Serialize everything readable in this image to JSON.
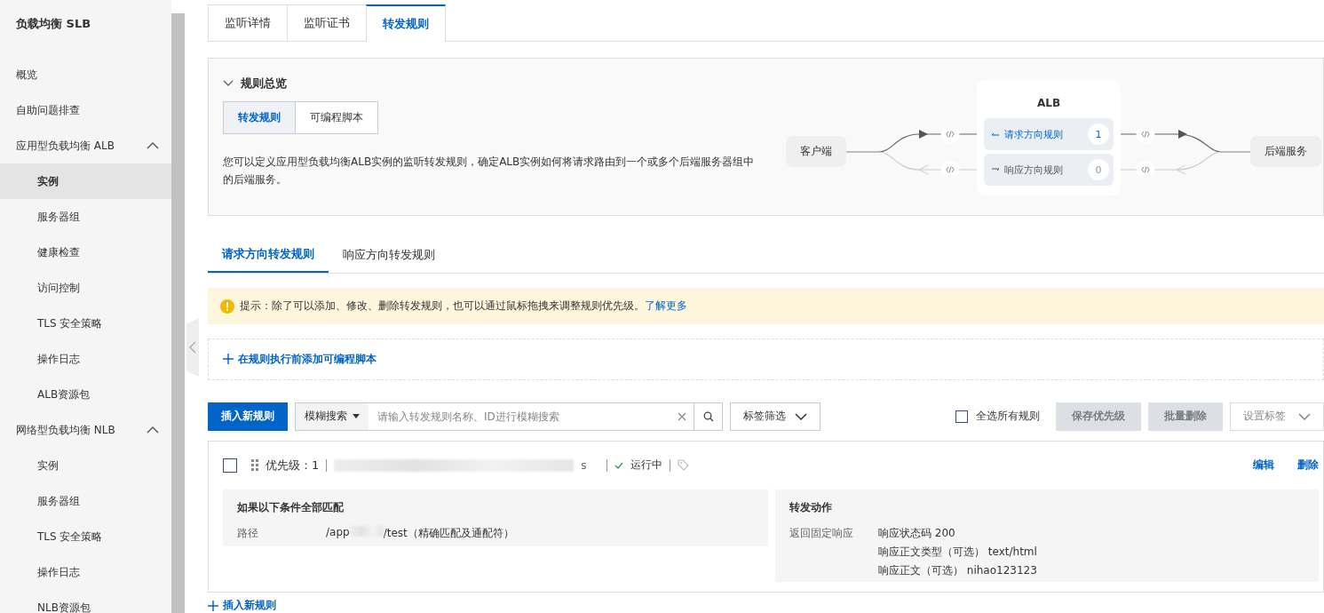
{
  "sidebar": {
    "title": "负载均衡 SLB",
    "items": [
      {
        "label": "概览",
        "selected": false
      },
      {
        "label": "自助问题排查",
        "selected": false
      },
      {
        "label": "应用型负载均衡 ALB",
        "expanded": true,
        "children": [
          {
            "label": "实例",
            "selected": true
          },
          {
            "label": "服务器组",
            "selected": false
          },
          {
            "label": "健康检查",
            "selected": false
          },
          {
            "label": "访问控制",
            "selected": false
          },
          {
            "label": "TLS 安全策略",
            "selected": false
          },
          {
            "label": "操作日志",
            "selected": false
          },
          {
            "label": "ALB资源包",
            "selected": false
          }
        ]
      },
      {
        "label": "网络型负载均衡 NLB",
        "expanded": true,
        "children": [
          {
            "label": "实例",
            "selected": false
          },
          {
            "label": "服务器组",
            "selected": false
          },
          {
            "label": "TLS 安全策略",
            "selected": false
          },
          {
            "label": "操作日志",
            "selected": false
          },
          {
            "label": "NLB资源包",
            "selected": false
          }
        ]
      }
    ]
  },
  "tabs": [
    {
      "label": "监听详情",
      "selected": false
    },
    {
      "label": "监听证书",
      "selected": false
    },
    {
      "label": "转发规则",
      "selected": true
    }
  ],
  "overview": {
    "title": "规则总览",
    "expanded": true,
    "segments": [
      {
        "label": "转发规则",
        "selected": true
      },
      {
        "label": "可编程脚本",
        "selected": false
      }
    ],
    "description": "您可以定义应用型负载均衡ALB实例的监听转发规则，确定ALB实例如何将请求路由到一个或多个后端服务器组中的后端服务。",
    "diagram": {
      "client": "客户端",
      "alb": "ALB",
      "backend": "后端服务",
      "flows": [
        {
          "label": "请求方向规则",
          "count": "1",
          "active": true
        },
        {
          "label": "响应方向规则",
          "count": "0",
          "active": false
        }
      ]
    }
  },
  "rule_tabs": [
    {
      "label": "请求方向转发规则",
      "selected": true
    },
    {
      "label": "响应方向转发规则",
      "selected": false
    }
  ],
  "alert": {
    "text": "提示：除了可以添加、修改、删除转发规则，也可以通过鼠标拖拽来调整规则优先级。",
    "link": "了解更多"
  },
  "add_script": "在规则执行前添加可编程脚本",
  "toolbar": {
    "insert": "插入新规则",
    "search_mode": "模糊搜索",
    "search_placeholder": "请输入转发规则名称、ID进行模糊搜索",
    "tag_filter": "标签筛选",
    "select_all": {
      "label": "全选所有规则",
      "checked": false
    },
    "actions": [
      {
        "label": "保存优先级",
        "disabled": true
      },
      {
        "label": "批量删除",
        "disabled": true
      }
    ],
    "set_tag": {
      "label": "设置标签",
      "disabled": true
    }
  },
  "rules": [
    {
      "checked": false,
      "priority": "优先级：1",
      "name_tail": "s",
      "status": "运行中",
      "links": [
        "编辑",
        "删除"
      ],
      "conditions": {
        "title": "如果以下条件全部匹配",
        "key": "路径",
        "value_start": "/app",
        "value_end": "/test（精确匹配及通配符）"
      },
      "action": {
        "title": "转发动作",
        "key": "返回固定响应",
        "lines": [
          "响应状态码 200",
          "响应正文类型（可选） text/html",
          "响应正文（可选） nihao123123"
        ]
      }
    }
  ],
  "insert_bottom": "插入新规则"
}
